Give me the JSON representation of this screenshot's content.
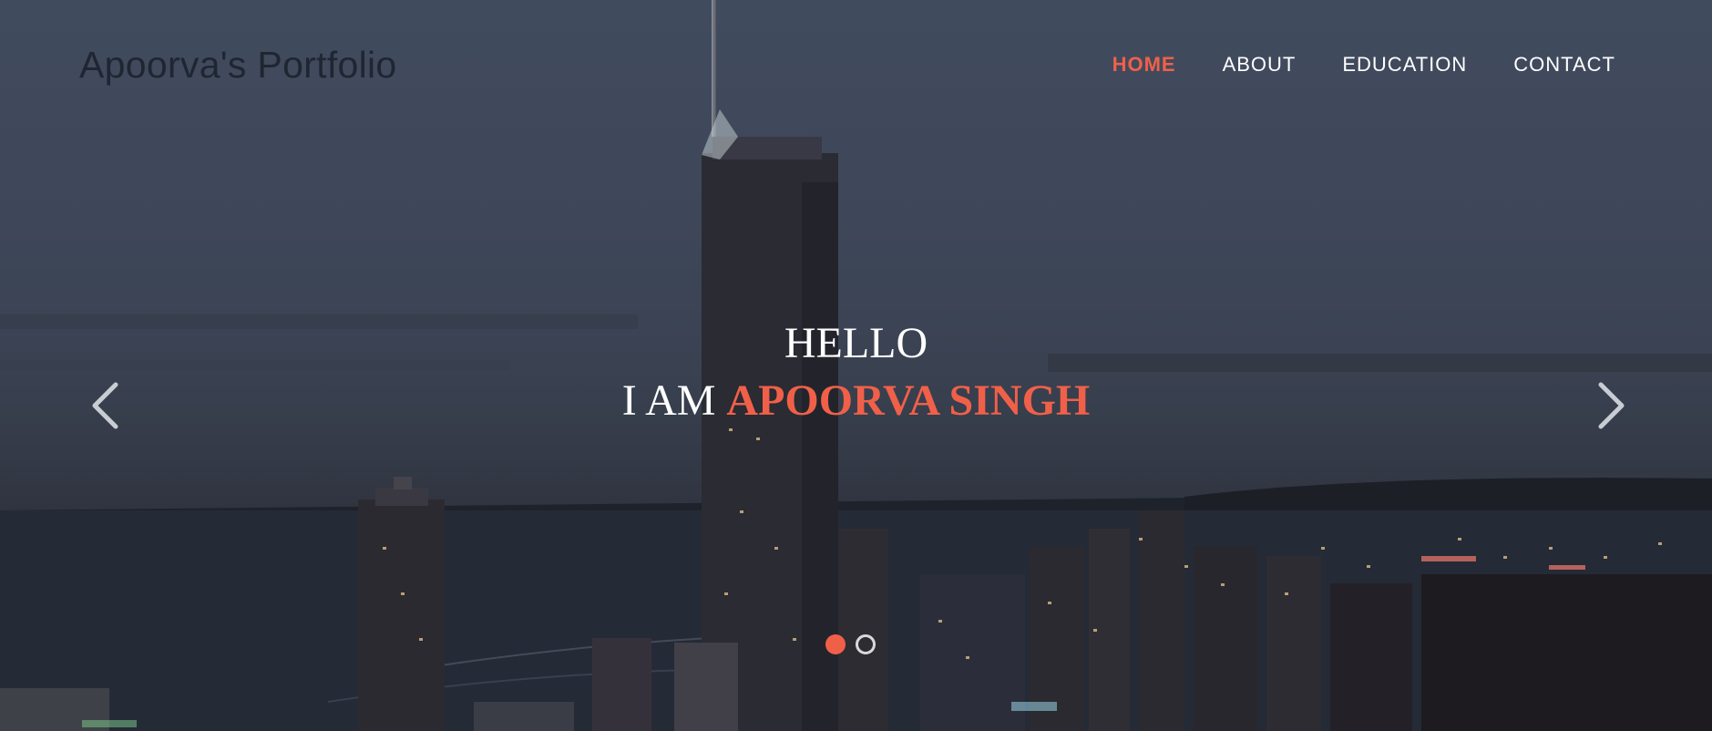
{
  "brand": {
    "title": "Apoorva's Portfolio"
  },
  "nav": {
    "items": [
      {
        "label": "HOME",
        "active": true
      },
      {
        "label": "ABOUT",
        "active": false
      },
      {
        "label": "EDUCATION",
        "active": false
      },
      {
        "label": "CONTACT",
        "active": false
      }
    ]
  },
  "hero": {
    "greeting": "HELLO",
    "intro": "I AM",
    "name": "APOORVA SINGH",
    "background_image": "city-skyline-at-night"
  },
  "carousel": {
    "prev_icon": "chevron-left-icon",
    "next_icon": "chevron-right-icon",
    "slide_count": 2,
    "active_slide": 1
  },
  "colors": {
    "accent": "#f06049",
    "text_light": "#ffffff",
    "brand_text": "#1f2632"
  }
}
